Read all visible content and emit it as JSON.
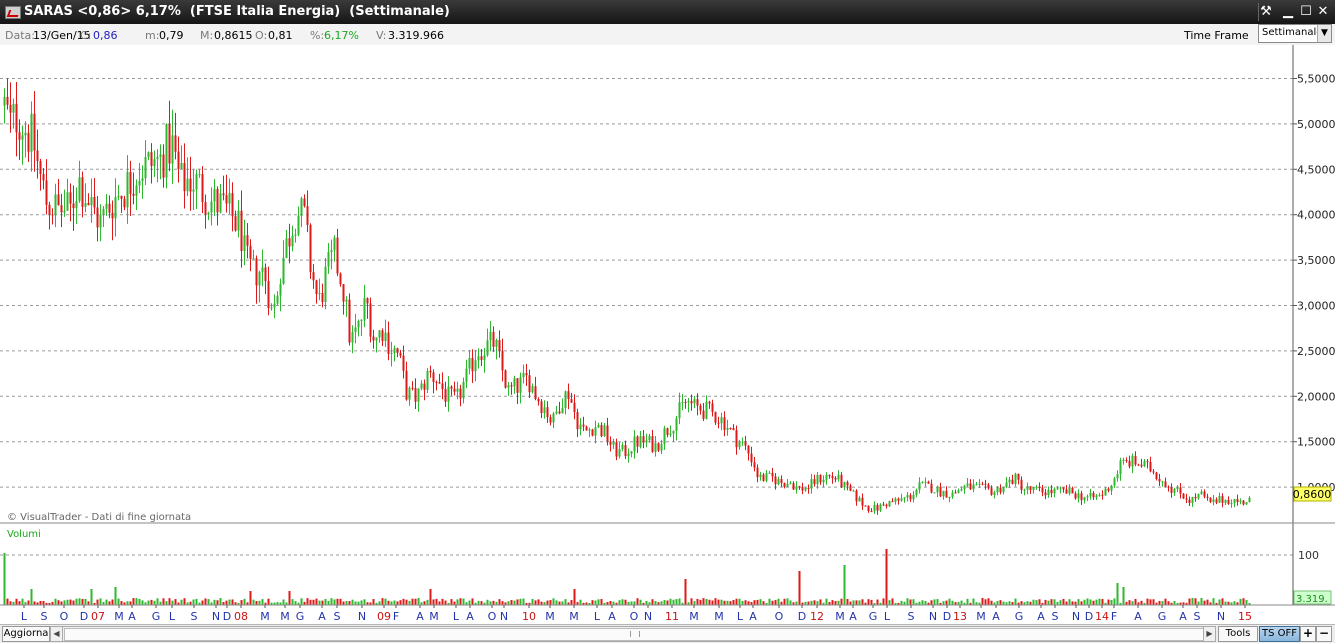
{
  "window": {
    "title": "SARAS <0,86> 6,17%  (FTSE Italia Energia)  (Settimanale)",
    "controls": {
      "tools": "⚒",
      "minimize": "▁",
      "maximize": "☐",
      "close": "✕"
    }
  },
  "info_bar": {
    "date_label": "Data:",
    "date_value": "13/Gen/15",
    "close_label": "C:",
    "close_value": "0,86",
    "min_label": "m:",
    "min_value": "0,79",
    "max_label": "M:",
    "max_value": "0,8615",
    "open_label": "O:",
    "open_value": "0,81",
    "pct_label": "%:",
    "pct_value": "6,17%",
    "volume_label": "V:",
    "volume_value": "3.319.966",
    "time_frame_label": "Time Frame",
    "time_frame_value": "Settimanale"
  },
  "colors": {
    "up": "#2db82d",
    "down": "#dd1a1a",
    "grid": "#9a9a9a",
    "background": "#ffffff",
    "price_box": "#ffff66",
    "volume_box": "#ccffcc"
  },
  "chart_data": {
    "type": "candlestick",
    "title": "SARAS <0,86> 6,17%  (FTSE Italia Energia)  (Settimanale)",
    "timeframe": "Settimanale",
    "period": "mid 2006 – 13/Gen/2015",
    "ylim": [
      0.6,
      5.8
    ],
    "yticks": [
      "5,5000",
      "5,0000",
      "4,5000",
      "4,0000",
      "3,5000",
      "3,0000",
      "2,5000",
      "2,0000",
      "1,5000",
      "1,0000"
    ],
    "last_price_label": "0,8600",
    "grid": true,
    "watermark": "© VisualTrader - Dati di fine giornata",
    "price_path": [
      [
        0,
        5.6
      ],
      [
        4,
        5.2
      ],
      [
        10,
        5.0
      ],
      [
        17,
        5.1
      ],
      [
        25,
        4.95
      ],
      [
        33,
        4.8
      ],
      [
        40,
        4.4
      ],
      [
        46,
        4.15
      ],
      [
        58,
        4.05
      ],
      [
        70,
        4.05
      ],
      [
        78,
        4.4
      ],
      [
        88,
        4.15
      ],
      [
        100,
        3.92
      ],
      [
        112,
        4.15
      ],
      [
        125,
        4.3
      ],
      [
        138,
        4.5
      ],
      [
        150,
        4.55
      ],
      [
        160,
        4.6
      ],
      [
        167,
        4.75
      ],
      [
        172,
        4.75
      ],
      [
        180,
        4.35
      ],
      [
        190,
        4.4
      ],
      [
        200,
        4.3
      ],
      [
        210,
        4.15
      ],
      [
        220,
        4.1
      ],
      [
        230,
        4.0
      ],
      [
        240,
        3.85
      ],
      [
        245,
        3.5
      ],
      [
        252,
        3.35
      ],
      [
        260,
        3.4
      ],
      [
        266,
        3.3
      ],
      [
        272,
        2.85
      ],
      [
        280,
        3.4
      ],
      [
        288,
        3.75
      ],
      [
        296,
        4.05
      ],
      [
        304,
        3.95
      ],
      [
        310,
        3.45
      ],
      [
        318,
        3.0
      ],
      [
        326,
        3.35
      ],
      [
        334,
        3.55
      ],
      [
        342,
        3.25
      ],
      [
        350,
        2.6
      ],
      [
        358,
        2.75
      ],
      [
        366,
        3.05
      ],
      [
        374,
        2.6
      ],
      [
        382,
        2.75
      ],
      [
        390,
        2.55
      ],
      [
        398,
        2.45
      ],
      [
        406,
        2.05
      ],
      [
        414,
        1.98
      ],
      [
        420,
        2.05
      ],
      [
        428,
        2.25
      ],
      [
        436,
        2.2
      ],
      [
        446,
        2.0
      ],
      [
        456,
        1.95
      ],
      [
        466,
        2.2
      ],
      [
        476,
        2.5
      ],
      [
        486,
        2.55
      ],
      [
        494,
        2.6
      ],
      [
        500,
        2.35
      ],
      [
        508,
        2.05
      ],
      [
        516,
        2.1
      ],
      [
        528,
        2.2
      ],
      [
        536,
        2.0
      ],
      [
        546,
        1.85
      ],
      [
        552,
        1.7
      ],
      [
        560,
        1.95
      ],
      [
        568,
        2.05
      ],
      [
        576,
        1.75
      ],
      [
        584,
        1.6
      ],
      [
        594,
        1.68
      ],
      [
        604,
        1.6
      ],
      [
        614,
        1.4
      ],
      [
        624,
        1.38
      ],
      [
        636,
        1.5
      ],
      [
        646,
        1.5
      ],
      [
        656,
        1.45
      ],
      [
        664,
        1.6
      ],
      [
        672,
        1.7
      ],
      [
        680,
        1.85
      ],
      [
        686,
        1.95
      ],
      [
        694,
        1.88
      ],
      [
        704,
        1.85
      ],
      [
        714,
        1.8
      ],
      [
        724,
        1.72
      ],
      [
        734,
        1.55
      ],
      [
        744,
        1.45
      ],
      [
        752,
        1.3
      ],
      [
        758,
        1.1
      ],
      [
        764,
        1.1
      ],
      [
        772,
        1.1
      ],
      [
        780,
        1.05
      ],
      [
        790,
        1.05
      ],
      [
        798,
        0.98
      ],
      [
        808,
        1.0
      ],
      [
        816,
        1.08
      ],
      [
        826,
        1.12
      ],
      [
        836,
        1.1
      ],
      [
        846,
        0.98
      ],
      [
        856,
        0.88
      ],
      [
        866,
        0.78
      ],
      [
        876,
        0.76
      ],
      [
        886,
        0.82
      ],
      [
        898,
        0.85
      ],
      [
        910,
        0.9
      ],
      [
        920,
        1.02
      ],
      [
        930,
        1.0
      ],
      [
        940,
        0.95
      ],
      [
        952,
        0.92
      ],
      [
        962,
        1.0
      ],
      [
        972,
        1.0
      ],
      [
        982,
        0.98
      ],
      [
        994,
        0.95
      ],
      [
        1004,
        1.02
      ],
      [
        1014,
        1.1
      ],
      [
        1024,
        0.98
      ],
      [
        1036,
        0.96
      ],
      [
        1048,
        0.95
      ],
      [
        1060,
        0.95
      ],
      [
        1070,
        0.94
      ],
      [
        1080,
        0.9
      ],
      [
        1092,
        0.88
      ],
      [
        1102,
        0.92
      ],
      [
        1112,
        1.05
      ],
      [
        1120,
        1.25
      ],
      [
        1130,
        1.28
      ],
      [
        1140,
        1.25
      ],
      [
        1150,
        1.2
      ],
      [
        1160,
        1.1
      ],
      [
        1172,
        0.98
      ],
      [
        1182,
        0.92
      ],
      [
        1190,
        0.85
      ],
      [
        1200,
        0.92
      ],
      [
        1210,
        0.82
      ],
      [
        1220,
        0.86
      ],
      [
        1232,
        0.86
      ],
      [
        1240,
        0.83
      ],
      [
        1248,
        0.86
      ]
    ],
    "volume_panel": {
      "label": "Volumi",
      "ytick": "100",
      "last_value_label": "3.319.",
      "spikes": [
        [
          4,
          52
        ],
        [
          30,
          16
        ],
        [
          90,
          16
        ],
        [
          115,
          18
        ],
        [
          250,
          14
        ],
        [
          290,
          14
        ],
        [
          430,
          16
        ],
        [
          575,
          16
        ],
        [
          684,
          26
        ],
        [
          800,
          34
        ],
        [
          845,
          40
        ],
        [
          885,
          56
        ],
        [
          1116,
          22
        ],
        [
          1124,
          18
        ]
      ]
    },
    "x_axis": {
      "tick_labels": [
        {
          "text": "L",
          "x": 24,
          "color": "blue"
        },
        {
          "text": "S",
          "x": 44,
          "color": "blue"
        },
        {
          "text": "O",
          "x": 64,
          "color": "blue"
        },
        {
          "text": "D",
          "x": 84,
          "color": "blue"
        },
        {
          "text": "07",
          "x": 98,
          "color": "red"
        },
        {
          "text": "M",
          "x": 119,
          "color": "blue"
        },
        {
          "text": "A",
          "x": 132,
          "color": "blue"
        },
        {
          "text": "G",
          "x": 156,
          "color": "blue"
        },
        {
          "text": "L",
          "x": 172,
          "color": "blue"
        },
        {
          "text": "S",
          "x": 194,
          "color": "blue"
        },
        {
          "text": "N",
          "x": 216,
          "color": "blue"
        },
        {
          "text": "D",
          "x": 227,
          "color": "blue"
        },
        {
          "text": "08",
          "x": 241,
          "color": "red"
        },
        {
          "text": "M",
          "x": 265,
          "color": "blue"
        },
        {
          "text": "M",
          "x": 285,
          "color": "blue"
        },
        {
          "text": "G",
          "x": 300,
          "color": "blue"
        },
        {
          "text": "A",
          "x": 322,
          "color": "blue"
        },
        {
          "text": "S",
          "x": 337,
          "color": "blue"
        },
        {
          "text": "N",
          "x": 362,
          "color": "blue"
        },
        {
          "text": "09",
          "x": 384,
          "color": "red"
        },
        {
          "text": "F",
          "x": 396,
          "color": "blue"
        },
        {
          "text": "A",
          "x": 420,
          "color": "blue"
        },
        {
          "text": "M",
          "x": 434,
          "color": "blue"
        },
        {
          "text": "L",
          "x": 456,
          "color": "blue"
        },
        {
          "text": "A",
          "x": 470,
          "color": "blue"
        },
        {
          "text": "O",
          "x": 492,
          "color": "blue"
        },
        {
          "text": "N",
          "x": 504,
          "color": "blue"
        },
        {
          "text": "10",
          "x": 529,
          "color": "red"
        },
        {
          "text": "M",
          "x": 550,
          "color": "blue"
        },
        {
          "text": "M",
          "x": 574,
          "color": "blue"
        },
        {
          "text": "L",
          "x": 597,
          "color": "blue"
        },
        {
          "text": "A",
          "x": 612,
          "color": "blue"
        },
        {
          "text": "O",
          "x": 634,
          "color": "blue"
        },
        {
          "text": "N",
          "x": 648,
          "color": "blue"
        },
        {
          "text": "11",
          "x": 672,
          "color": "red"
        },
        {
          "text": "M",
          "x": 694,
          "color": "blue"
        },
        {
          "text": "M",
          "x": 719,
          "color": "blue"
        },
        {
          "text": "L",
          "x": 740,
          "color": "blue"
        },
        {
          "text": "A",
          "x": 753,
          "color": "blue"
        },
        {
          "text": "O",
          "x": 779,
          "color": "blue"
        },
        {
          "text": "D",
          "x": 802,
          "color": "blue"
        },
        {
          "text": "12",
          "x": 817,
          "color": "red"
        },
        {
          "text": "M",
          "x": 840,
          "color": "blue"
        },
        {
          "text": "A",
          "x": 853,
          "color": "blue"
        },
        {
          "text": "G",
          "x": 873,
          "color": "blue"
        },
        {
          "text": "L",
          "x": 887,
          "color": "blue"
        },
        {
          "text": "S",
          "x": 911,
          "color": "blue"
        },
        {
          "text": "N",
          "x": 933,
          "color": "blue"
        },
        {
          "text": "D",
          "x": 947,
          "color": "blue"
        },
        {
          "text": "13",
          "x": 960,
          "color": "red"
        },
        {
          "text": "M",
          "x": 981,
          "color": "blue"
        },
        {
          "text": "A",
          "x": 996,
          "color": "blue"
        },
        {
          "text": "G",
          "x": 1019,
          "color": "blue"
        },
        {
          "text": "A",
          "x": 1041,
          "color": "blue"
        },
        {
          "text": "S",
          "x": 1055,
          "color": "blue"
        },
        {
          "text": "N",
          "x": 1076,
          "color": "blue"
        },
        {
          "text": "D",
          "x": 1089,
          "color": "blue"
        },
        {
          "text": "14",
          "x": 1102,
          "color": "red"
        },
        {
          "text": "F",
          "x": 1114,
          "color": "blue"
        },
        {
          "text": "A",
          "x": 1138,
          "color": "blue"
        },
        {
          "text": "G",
          "x": 1162,
          "color": "blue"
        },
        {
          "text": "A",
          "x": 1183,
          "color": "blue"
        },
        {
          "text": "S",
          "x": 1197,
          "color": "blue"
        },
        {
          "text": "N",
          "x": 1221,
          "color": "blue"
        },
        {
          "text": "15",
          "x": 1245,
          "color": "red"
        }
      ]
    }
  },
  "bottom_bar": {
    "refresh_label": "Aggiorna",
    "tools_label": "Tools",
    "ts_label": "TS OFF",
    "plus": "+",
    "minus": "−",
    "scroll_left": "◀",
    "scroll_right": "▶"
  }
}
